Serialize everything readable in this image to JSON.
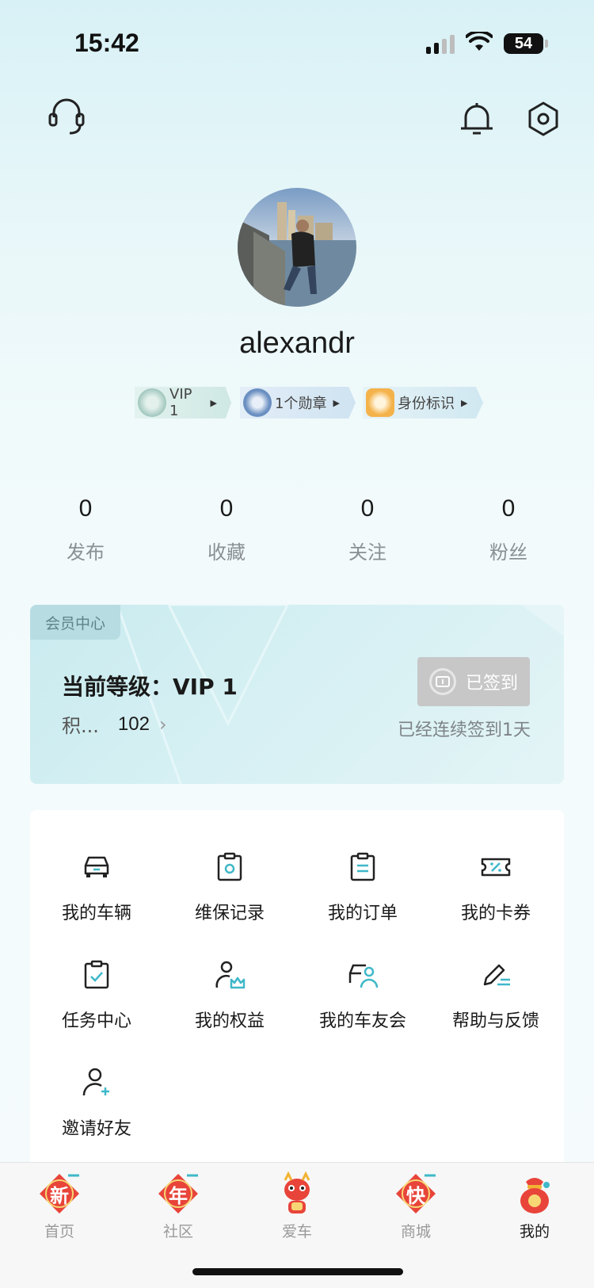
{
  "status_bar": {
    "time": "15:42",
    "battery": "54"
  },
  "profile": {
    "username": "alexandr",
    "badges": [
      {
        "label": "VIP 1",
        "icon": "vip-level-icon",
        "color": "#dcefed"
      },
      {
        "label": "1个勋章",
        "icon": "medal-icon",
        "color": "#dcedf7"
      },
      {
        "label": "身份标识",
        "icon": "identity-icon",
        "color": "#e2f1f6"
      }
    ]
  },
  "stats": [
    {
      "value": "0",
      "label": "发布"
    },
    {
      "value": "0",
      "label": "收藏"
    },
    {
      "value": "0",
      "label": "关注"
    },
    {
      "value": "0",
      "label": "粉丝"
    }
  ],
  "member": {
    "tag": "会员中心",
    "level_text": "当前等级：VIP 1",
    "points_label": "积...",
    "points_value": "102",
    "signin_label": "已签到",
    "streak_text": "已经连续签到1天"
  },
  "menu": [
    {
      "label": "我的车辆",
      "icon": "car-icon"
    },
    {
      "label": "维保记录",
      "icon": "maintenance-record-icon"
    },
    {
      "label": "我的订单",
      "icon": "order-icon"
    },
    {
      "label": "我的卡券",
      "icon": "coupon-icon"
    },
    {
      "label": "任务中心",
      "icon": "task-icon"
    },
    {
      "label": "我的权益",
      "icon": "benefits-icon"
    },
    {
      "label": "我的车友会",
      "icon": "car-club-icon"
    },
    {
      "label": "帮助与反馈",
      "icon": "feedback-icon"
    },
    {
      "label": "邀请好友",
      "icon": "invite-friend-icon"
    }
  ],
  "tabs": [
    {
      "label": "首页",
      "glyph": "新",
      "icon": "home-icon"
    },
    {
      "label": "社区",
      "glyph": "年",
      "icon": "community-icon"
    },
    {
      "label": "爱车",
      "glyph": "",
      "icon": "dragon-icon"
    },
    {
      "label": "商城",
      "glyph": "快",
      "icon": "mall-icon"
    },
    {
      "label": "我的",
      "glyph": "",
      "icon": "lucky-bag-icon"
    }
  ],
  "colors": {
    "accent": "#3fb8c9",
    "tab_red": "#e8443a",
    "text": "#1a1a1a",
    "muted": "#8a8f93"
  }
}
